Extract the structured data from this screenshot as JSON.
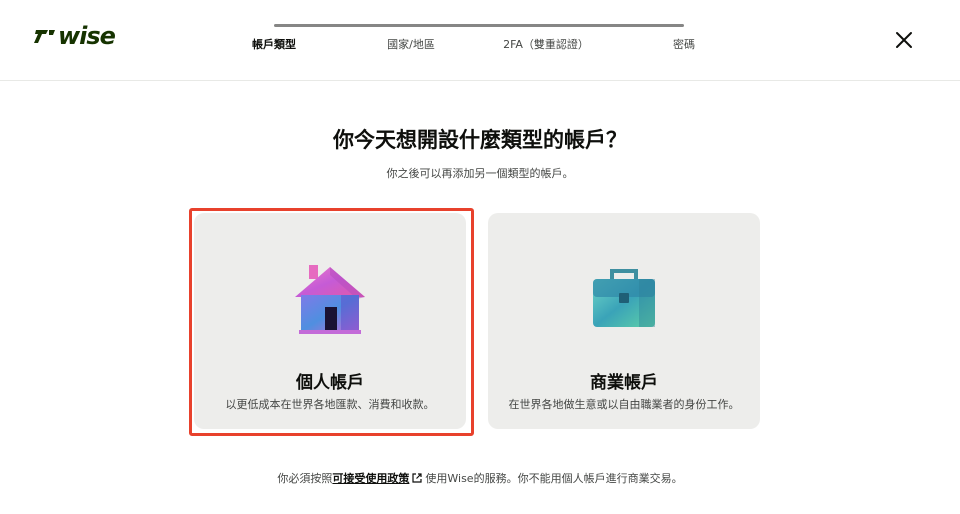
{
  "brand": {
    "logo_text": "wise",
    "color": "#163300"
  },
  "progress": {
    "steps": [
      {
        "label": "帳戶類型",
        "active": true
      },
      {
        "label": "國家/地區",
        "active": false
      },
      {
        "label": "2FA（雙重認證）",
        "active": false
      },
      {
        "label": "密碼",
        "active": false
      }
    ]
  },
  "header": {
    "close_icon": "close-icon"
  },
  "main": {
    "title": "你今天想開設什麼類型的帳戶？",
    "subtitle": "你之後可以再添加另一個類型的帳戶。"
  },
  "cards": [
    {
      "title": "個人帳戶",
      "description": "以更低成本在世界各地匯款、消費和收款。",
      "icon": "house-illustration"
    },
    {
      "title": "商業帳戶",
      "description": "在世界各地做生意或以自由職業者的身份工作。",
      "icon": "briefcase-illustration"
    }
  ],
  "footer": {
    "prefix": "你必須按照",
    "link": "可接受使用政策",
    "link_icon": "external-link-icon",
    "suffix": "使用Wise的服務。你不能用個人帳戶進行商業交易。"
  },
  "colors": {
    "highlight": "#e8412c",
    "card_bg": "#ededeb",
    "accent": "#163300"
  }
}
